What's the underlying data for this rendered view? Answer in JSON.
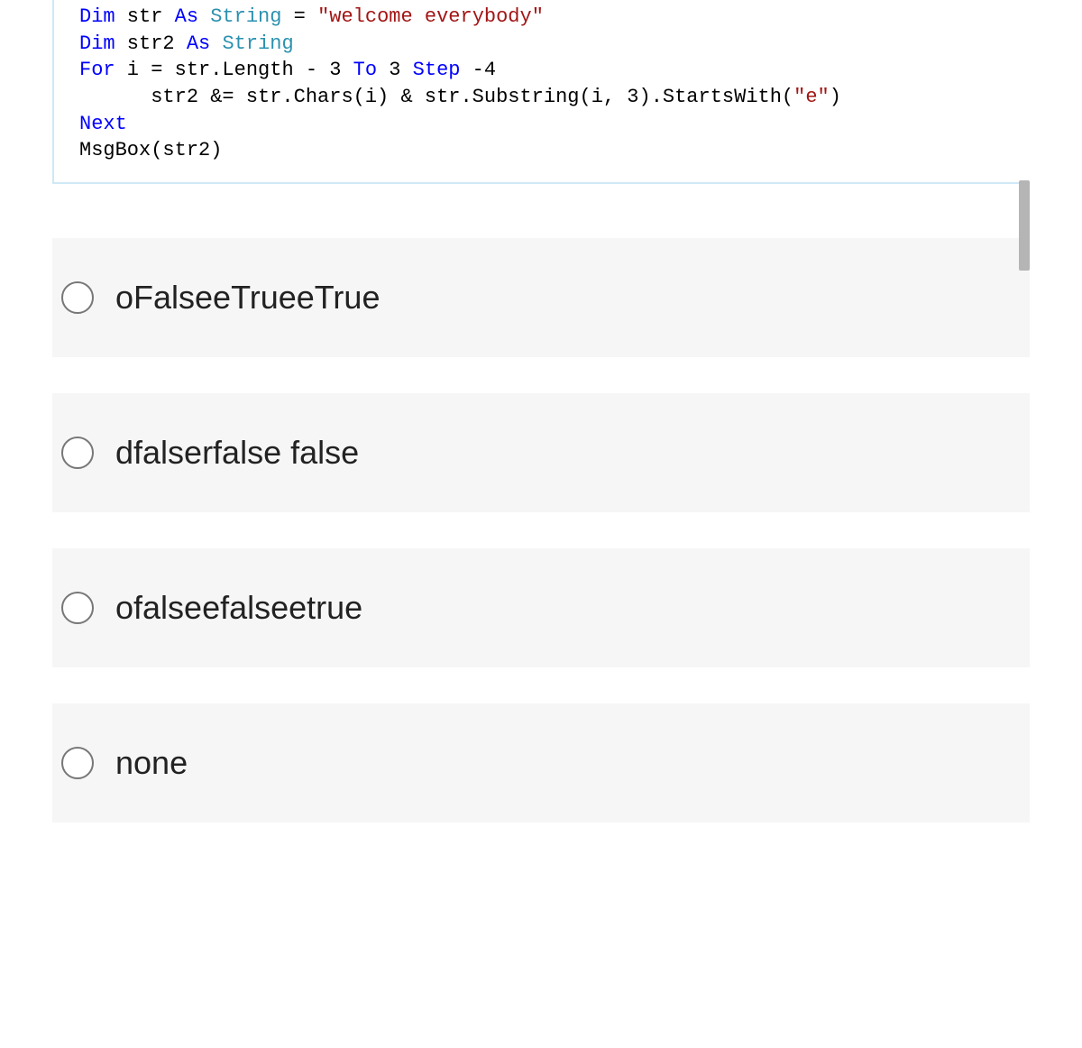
{
  "code": {
    "line1": {
      "t1": "Dim",
      "t2": " str ",
      "t3": "As",
      "t4": " ",
      "t5": "String",
      "t6": " = ",
      "t7": "\"welcome everybody\""
    },
    "line2": {
      "t1": "Dim",
      "t2": " str2 ",
      "t3": "As",
      "t4": " ",
      "t5": "String"
    },
    "line3": {
      "t1": "For",
      "t2": " i = str.Length - 3 ",
      "t3": "To",
      "t4": " 3 ",
      "t5": "Step",
      "t6": " -4"
    },
    "line4": {
      "t1": "      str2 &= str.Chars(i) & str.Substring(i, 3).StartsWith(",
      "t2": "\"e\"",
      "t3": ")"
    },
    "line5": {
      "t1": "Next"
    },
    "line6": {
      "t1": "MsgBox(str2)"
    }
  },
  "options": [
    {
      "label": "oFalseeTrueeTrue"
    },
    {
      "label": "dfalserfalse false"
    },
    {
      "label": "ofalseefalseetrue"
    },
    {
      "label": "none"
    }
  ]
}
